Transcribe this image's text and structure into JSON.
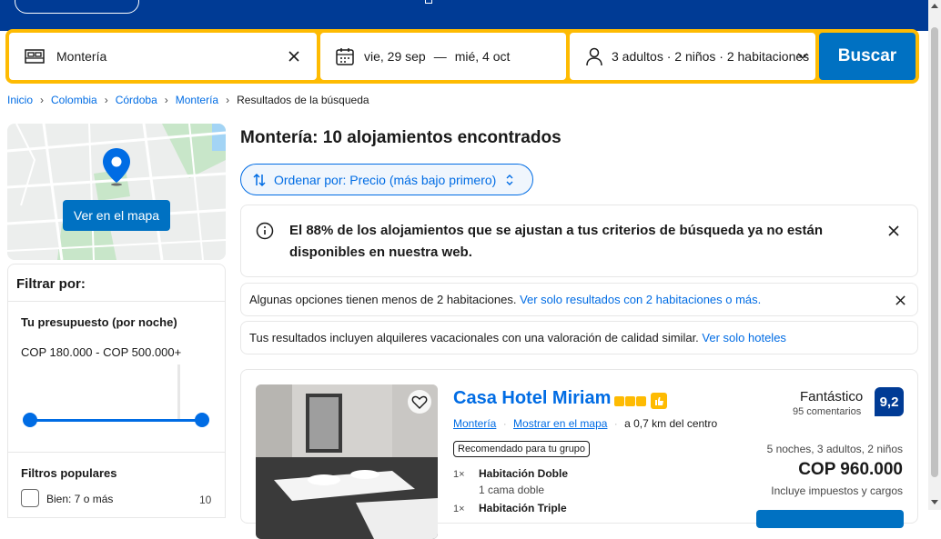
{
  "colors": {
    "brand": "#003b95",
    "accent": "#0071c2",
    "link": "#006ce4",
    "search_border": "#febb02"
  },
  "search": {
    "destination": "Montería",
    "clear_icon": "close-icon",
    "checkin": "vie, 29 sep",
    "dash": "—",
    "checkout": "mié, 4 oct",
    "occupancy": "3 adultos · 2 niños · 2 habitaciones",
    "button": "Buscar"
  },
  "breadcrumb": [
    "Inicio",
    "Colombia",
    "Córdoba",
    "Montería",
    "Resultados de la búsqueda"
  ],
  "map": {
    "button": "Ver en el mapa"
  },
  "filters": {
    "title": "Filtrar por:",
    "budget_title": "Tu presupuesto (por noche)",
    "budget_range": "COP 180.000 - COP 500.000+",
    "budget_min_fraction": 0,
    "budget_max_fraction": 1,
    "popular_title": "Filtros populares",
    "items": [
      {
        "label": "Bien: 7 o más",
        "count": "10"
      }
    ]
  },
  "results": {
    "title": "Montería: 10 alojamientos encontrados",
    "sort": "Ordenar por: Precio (más bajo primero)",
    "alert": "El 88% de los alojamientos que se ajustan a tus criterios de búsqueda ya no están disponibles en nuestra web.",
    "note1_text": "Algunas opciones tienen menos de 2 habitaciones.",
    "note1_link": "Ver solo resultados con 2 habitaciones o más.",
    "note2_text": "Tus resultados incluyen alquileres vacacionales con una valoración de calidad similar.",
    "note2_link": "Ver solo hoteles"
  },
  "hotel": {
    "name": "Casa Hotel Miriam",
    "stars": 3,
    "location": "Montería",
    "show_map": "Mostrar en el mapa",
    "distance": "a 0,7 km del centro",
    "tag": "Recomendado para tu grupo",
    "rooms": [
      {
        "qty": "1×",
        "name": "Habitación Doble",
        "beds": "1 cama doble"
      },
      {
        "qty": "1×",
        "name": "Habitación Triple",
        "beds": ""
      }
    ],
    "score_word": "Fantástico",
    "reviews": "95 comentarios",
    "score": "9,2",
    "nights": "5 noches, 3 adultos, 2 niños",
    "price": "COP 960.000",
    "taxes": "Incluye impuestos y cargos"
  }
}
